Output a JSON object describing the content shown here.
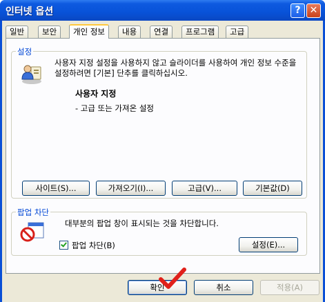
{
  "window": {
    "title": "인터넷 옵션",
    "help_button": "?",
    "close_button": "✕"
  },
  "tabs": [
    {
      "label": "일반"
    },
    {
      "label": "보안"
    },
    {
      "label": "개인 정보"
    },
    {
      "label": "내용"
    },
    {
      "label": "연결"
    },
    {
      "label": "프로그램"
    },
    {
      "label": "고급"
    }
  ],
  "settings": {
    "group_label": "설정",
    "description": "사용자 지정 설정을 사용하지 않고 슬라이더를 사용하여 개인 정보 수준을 설정하려면 [기본] 단추를 클릭하십시오.",
    "level_title": "사용자 지정",
    "level_subtitle": "- 고급 또는 가져온 설정",
    "buttons": {
      "sites": "사이트(S)...",
      "import": "가져오기(I)...",
      "advanced": "고급(V)...",
      "default": "기본값(D)"
    }
  },
  "popup": {
    "group_label": "팝업 차단",
    "description": "대부분의 팝업 창이 표시되는 것을 차단합니다.",
    "checkbox_label": "팝업 차단(B)",
    "checkbox_checked": true,
    "settings_button": "설정(E)..."
  },
  "footer": {
    "ok": "확인",
    "cancel": "취소",
    "apply": "적용(A)"
  },
  "colors": {
    "titlebar": "#0a4fd6",
    "dialog_bg": "#ece9d8",
    "group_label": "#0046d5",
    "tab_highlight": "#ffc83c",
    "checkmark": "#21a121",
    "annotation_check": "#e0201a"
  },
  "icons": {
    "settings_icon": "user-privacy-icon",
    "popup_icon": "popup-blocker-icon",
    "annotation": "red-checkmark-icon"
  }
}
